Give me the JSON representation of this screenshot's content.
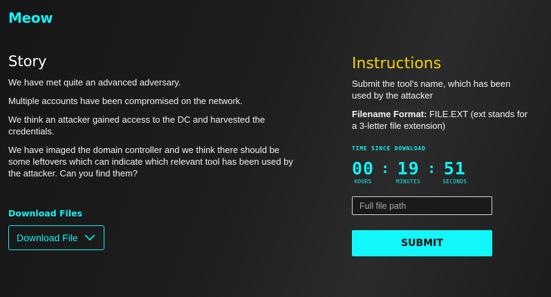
{
  "header": {
    "title": "Meow"
  },
  "story": {
    "title": "Story",
    "paragraphs": [
      "We have met quite an advanced adversary.",
      "Multiple accounts have been compromised on the network.",
      "We think an attacker gained access to the DC and harvested the credentials.",
      "We have imaged the domain controller and we think there should be some leftovers which can indicate which relevant tool has been used by the attacker. Can you find them?"
    ]
  },
  "download": {
    "label": "Download Files",
    "button_label": "Download File",
    "icon": "chevron-down-icon"
  },
  "instructions": {
    "title": "Instructions",
    "text": "Submit the tool's name, which has been used by the attacker",
    "format_label": "Filename Format:",
    "format_text": " FILE.EXT (ext stands for a 3-letter file extension)"
  },
  "timer": {
    "label": "Time since download",
    "hours": "00",
    "minutes": "19",
    "seconds": "51",
    "hours_label": "Hours",
    "minutes_label": "Minutes",
    "seconds_label": "Seconds"
  },
  "answer": {
    "placeholder": "Full file path",
    "value": "",
    "submit_label": "SUBMIT"
  },
  "colors": {
    "accent": "#13f2f6",
    "instructions_title": "#f5d10e",
    "background": "#1e1e1e"
  }
}
